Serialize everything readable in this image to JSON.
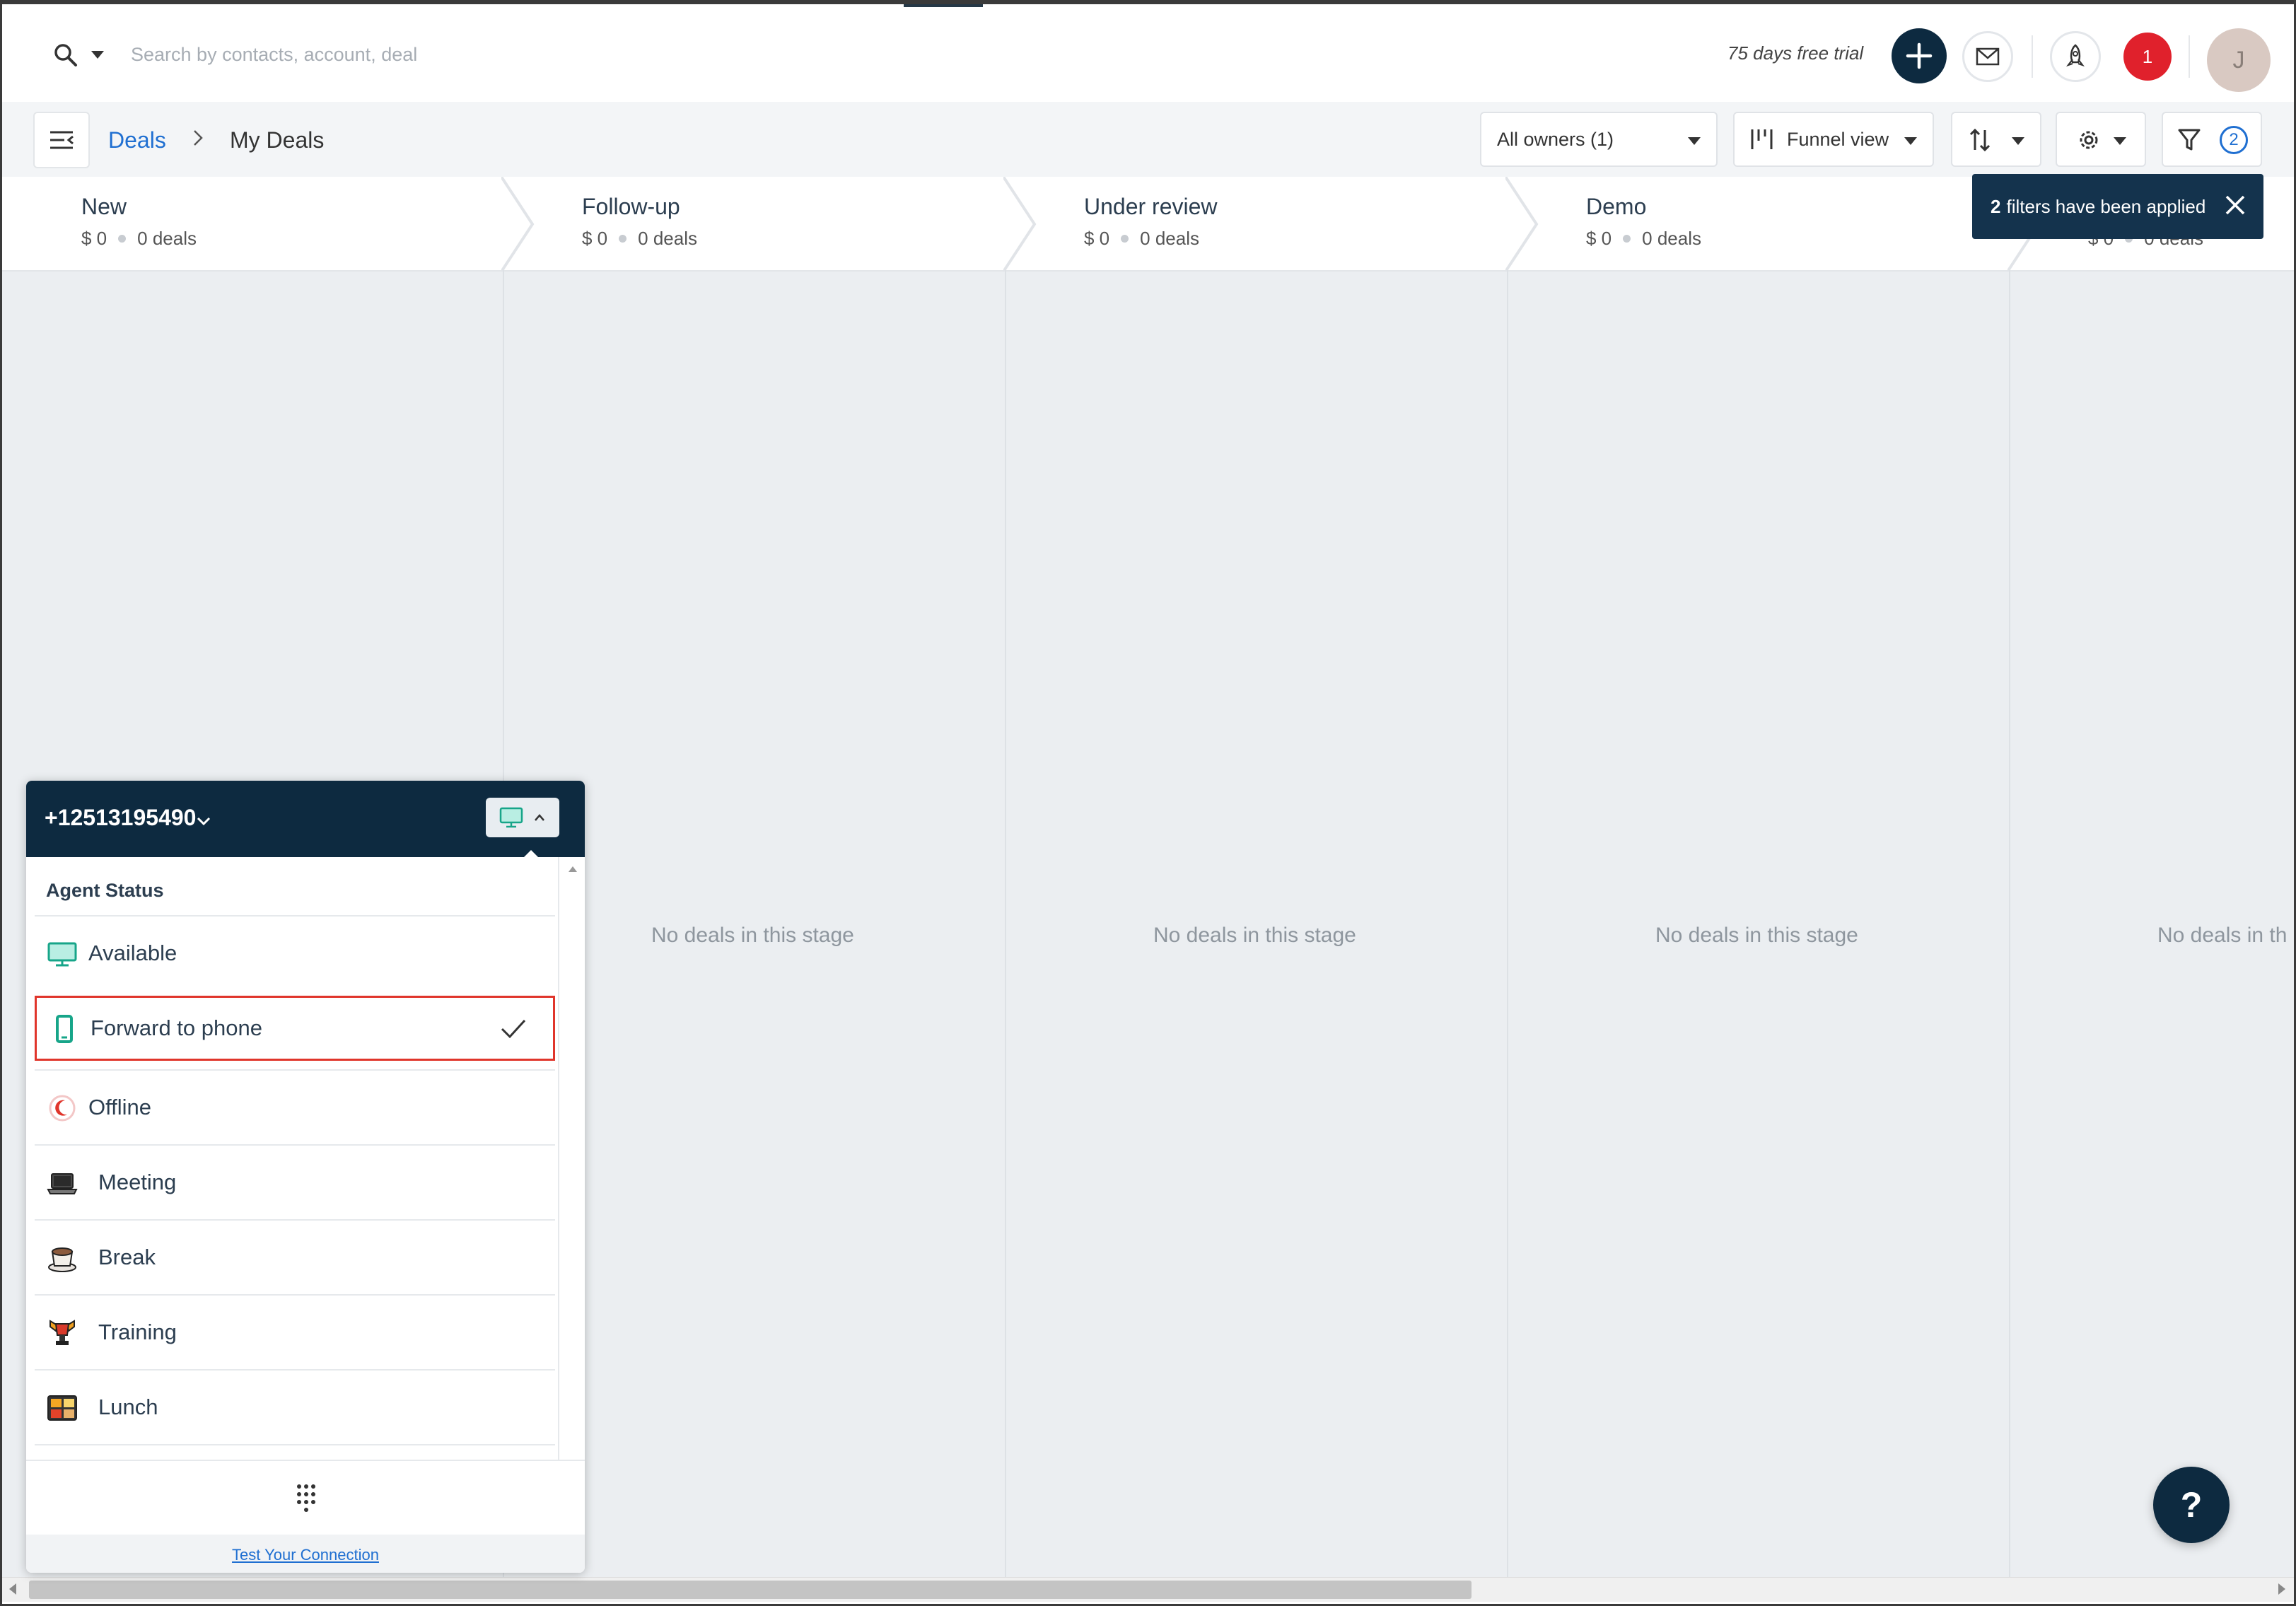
{
  "search": {
    "placeholder": "Search by contacts, account, deal"
  },
  "topbar": {
    "trial_text": "75 days free trial",
    "notification_count": "1",
    "avatar_initial": "J"
  },
  "breadcrumb": {
    "root": "Deals",
    "current": "My Deals"
  },
  "toolbar": {
    "owners_label": "All owners (1)",
    "view_label": "Funnel view",
    "filter_count": "2"
  },
  "toast": {
    "count": "2",
    "text": "filters have been applied"
  },
  "stages": [
    {
      "title": "New",
      "amount": "$ 0",
      "deals": "0 deals",
      "empty": "No deals in this stage"
    },
    {
      "title": "Follow-up",
      "amount": "$ 0",
      "deals": "0 deals",
      "empty": "No deals in this stage"
    },
    {
      "title": "Under review",
      "amount": "$ 0",
      "deals": "0 deals",
      "empty": "No deals in this stage"
    },
    {
      "title": "Demo",
      "amount": "$ 0",
      "deals": "0 deals",
      "empty": "No deals in this stage"
    },
    {
      "title": "",
      "amount": "$ 0",
      "deals": "0 deals",
      "empty": "No deals in th"
    }
  ],
  "phone_widget": {
    "number": "+12513195490",
    "section_title": "Agent Status",
    "statuses": [
      {
        "label": "Available",
        "icon": "monitor-icon"
      },
      {
        "label": "Forward to phone",
        "icon": "mobile-phone-icon",
        "selected": true
      },
      {
        "label": "Offline",
        "icon": "offline-moon-icon"
      },
      {
        "label": "Meeting",
        "icon": "laptop-icon"
      },
      {
        "label": "Break",
        "icon": "coffee-cup-icon"
      },
      {
        "label": "Training",
        "icon": "trophy-icon"
      },
      {
        "label": "Lunch",
        "icon": "bento-box-icon"
      }
    ],
    "footer_link": "Test Your Connection"
  },
  "help": {
    "label": "?"
  },
  "colors": {
    "navy": "#0d2a40",
    "link_blue": "#1f6fd1",
    "notif_red": "#e0212c",
    "selected_border": "#e0352b",
    "available_green": "#17a589"
  }
}
